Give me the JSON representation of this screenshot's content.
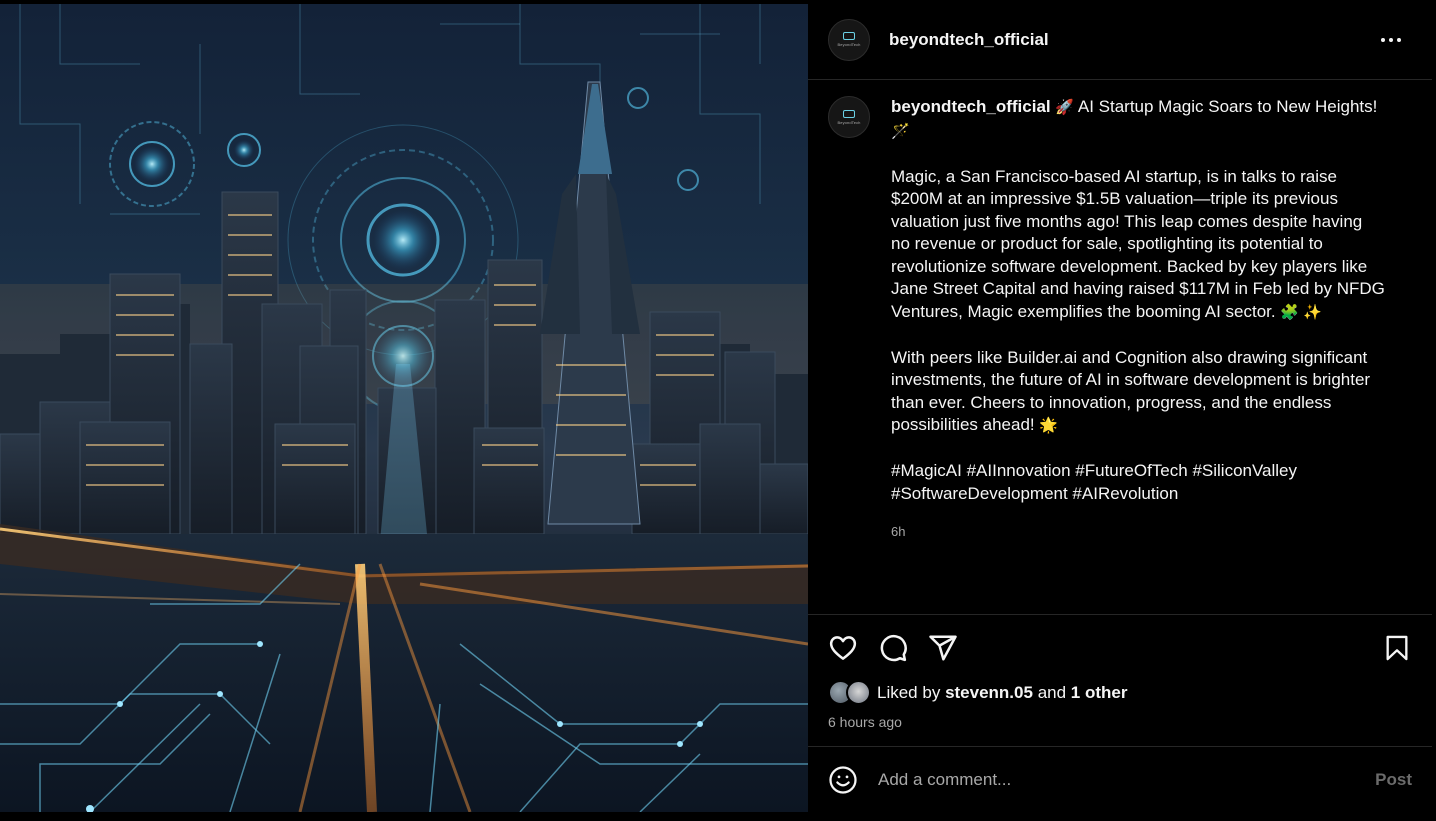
{
  "post": {
    "username": "beyondtech_official",
    "avatar_text": "BeyondTech",
    "caption": {
      "title": "AI Startup Magic Soars to New Heights!",
      "title_lead_emoji": "🚀",
      "title_trail_emoji": "🪄",
      "paragraph1_line1": "Magic, a San Francisco-based AI startup, is in talks to raise",
      "paragraph1_line2": "$200M at an impressive $1.5B valuation—triple its previous",
      "paragraph1_line3": "valuation just five months ago! This leap comes despite having",
      "paragraph1_line4": "no revenue or product for sale, spotlighting its potential to",
      "paragraph1_line5": "revolutionize software development. Backed by key players like",
      "paragraph1_line6": "Jane Street Capital and having raised $117M in Feb led by NFDG",
      "paragraph1_line7": "Ventures, Magic exemplifies the booming AI sector.",
      "paragraph1_emoji": "🧩 ✨",
      "paragraph2_line1": "With peers like Builder.ai and Cognition also drawing significant",
      "paragraph2_line2": "investments, the future of AI in software development is brighter",
      "paragraph2_line3": "than ever. Cheers to innovation, progress, and the endless",
      "paragraph2_line4": "possibilities ahead!",
      "paragraph2_emoji": "🌟",
      "hashtags_line1": "#MagicAI #AIInnovation #FutureOfTech #SiliconValley",
      "hashtags_line2": "#SoftwareDevelopment #AIRevolution"
    },
    "caption_time": "6h",
    "likes": {
      "prefix": "Liked by",
      "user": "stevenn.05",
      "joiner": "and",
      "others": "1 other"
    },
    "posted_ago": "6 hours ago"
  },
  "comment": {
    "placeholder": "Add a comment...",
    "post_label": "Post"
  },
  "icons": {
    "more": "more-options-icon",
    "like": "heart-icon",
    "comment": "comment-icon",
    "share": "share-icon",
    "save": "bookmark-icon",
    "emoji": "smiley-icon"
  },
  "colors": {
    "background": "#000000",
    "text": "#f5f5f5",
    "muted": "#a8a8a8",
    "divider": "#262626",
    "post_button_disabled": "#6b6b6b"
  }
}
